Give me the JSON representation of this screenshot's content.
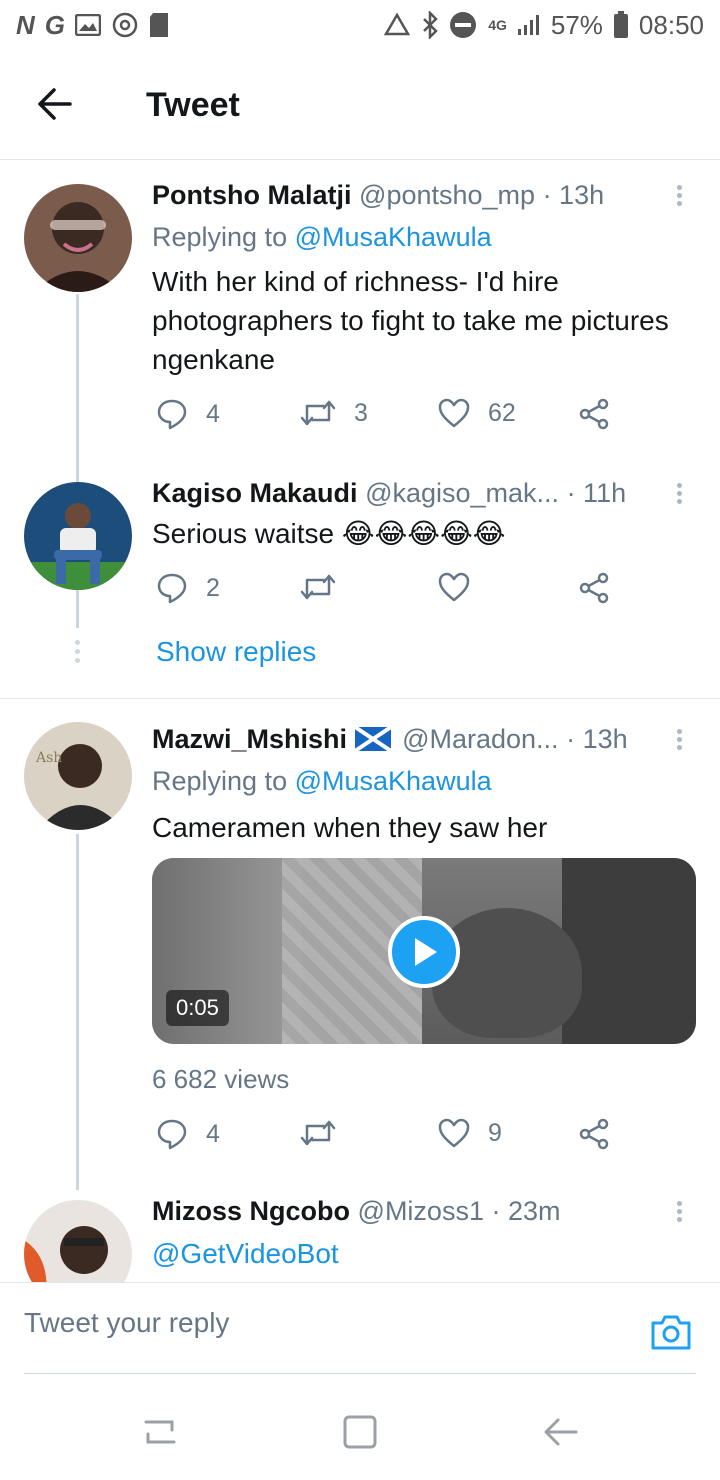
{
  "statusbar": {
    "left_icons": [
      "N",
      "G"
    ],
    "network": "4G",
    "battery": "57%",
    "time": "08:50"
  },
  "header": {
    "title": "Tweet"
  },
  "tweets": [
    {
      "name": "Pontsho Malatji",
      "handle": "@pontsho_mp",
      "time": "· 13h",
      "replying_prefix": "Replying to ",
      "replying_to": "@MusaKhawula",
      "text": "With her kind of richness- I'd hire photographers to fight to take me pictures ngenkane",
      "replies": "4",
      "retweets": "3",
      "likes": "62"
    },
    {
      "name": "Kagiso Makaudi",
      "handle": "@kagiso_mak...",
      "time": "· 11h",
      "text": "Serious waitse 😂😂😂😂😂",
      "replies": "2",
      "retweets": "",
      "likes": ""
    },
    {
      "name": "Mazwi_Mshishi",
      "handle": "@Maradon...",
      "time": "· 13h",
      "replying_prefix": "Replying to ",
      "replying_to": "@MusaKhawula",
      "text": "Cameramen when they saw her",
      "video_duration": "0:05",
      "views": "6 682 views",
      "replies": "4",
      "retweets": "",
      "likes": "9"
    },
    {
      "name": "Mizoss Ngcobo",
      "handle": "@Mizoss1",
      "time": "· 23m",
      "text": "@GetVideoBot"
    }
  ],
  "show_replies": "Show replies",
  "reply_bar": {
    "placeholder": "Tweet your reply"
  },
  "colors": {
    "accent": "#1da1f2",
    "link": "#1b95e0",
    "muted": "#657786",
    "text": "#14171a"
  }
}
